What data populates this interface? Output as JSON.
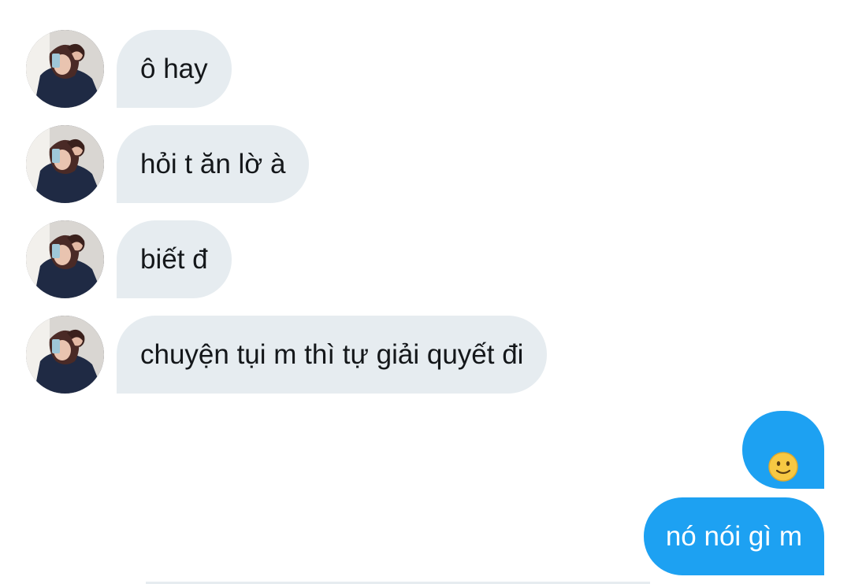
{
  "conversation": {
    "incoming": [
      {
        "text": "ô hay"
      },
      {
        "text": "hỏi t ăn lờ à"
      },
      {
        "text": "biết đ"
      },
      {
        "text": "chuyện tụi m thì tự giải quyết đi"
      }
    ],
    "outgoing": [
      {
        "text": "",
        "icon": "slightly-smiling-face-emoji"
      },
      {
        "text": "nó nói gì m"
      }
    ]
  },
  "colors": {
    "incoming_bubble": "#e6ecf0",
    "outgoing_bubble": "#1da1f2",
    "incoming_text": "#14171a",
    "outgoing_text": "#ffffff"
  }
}
